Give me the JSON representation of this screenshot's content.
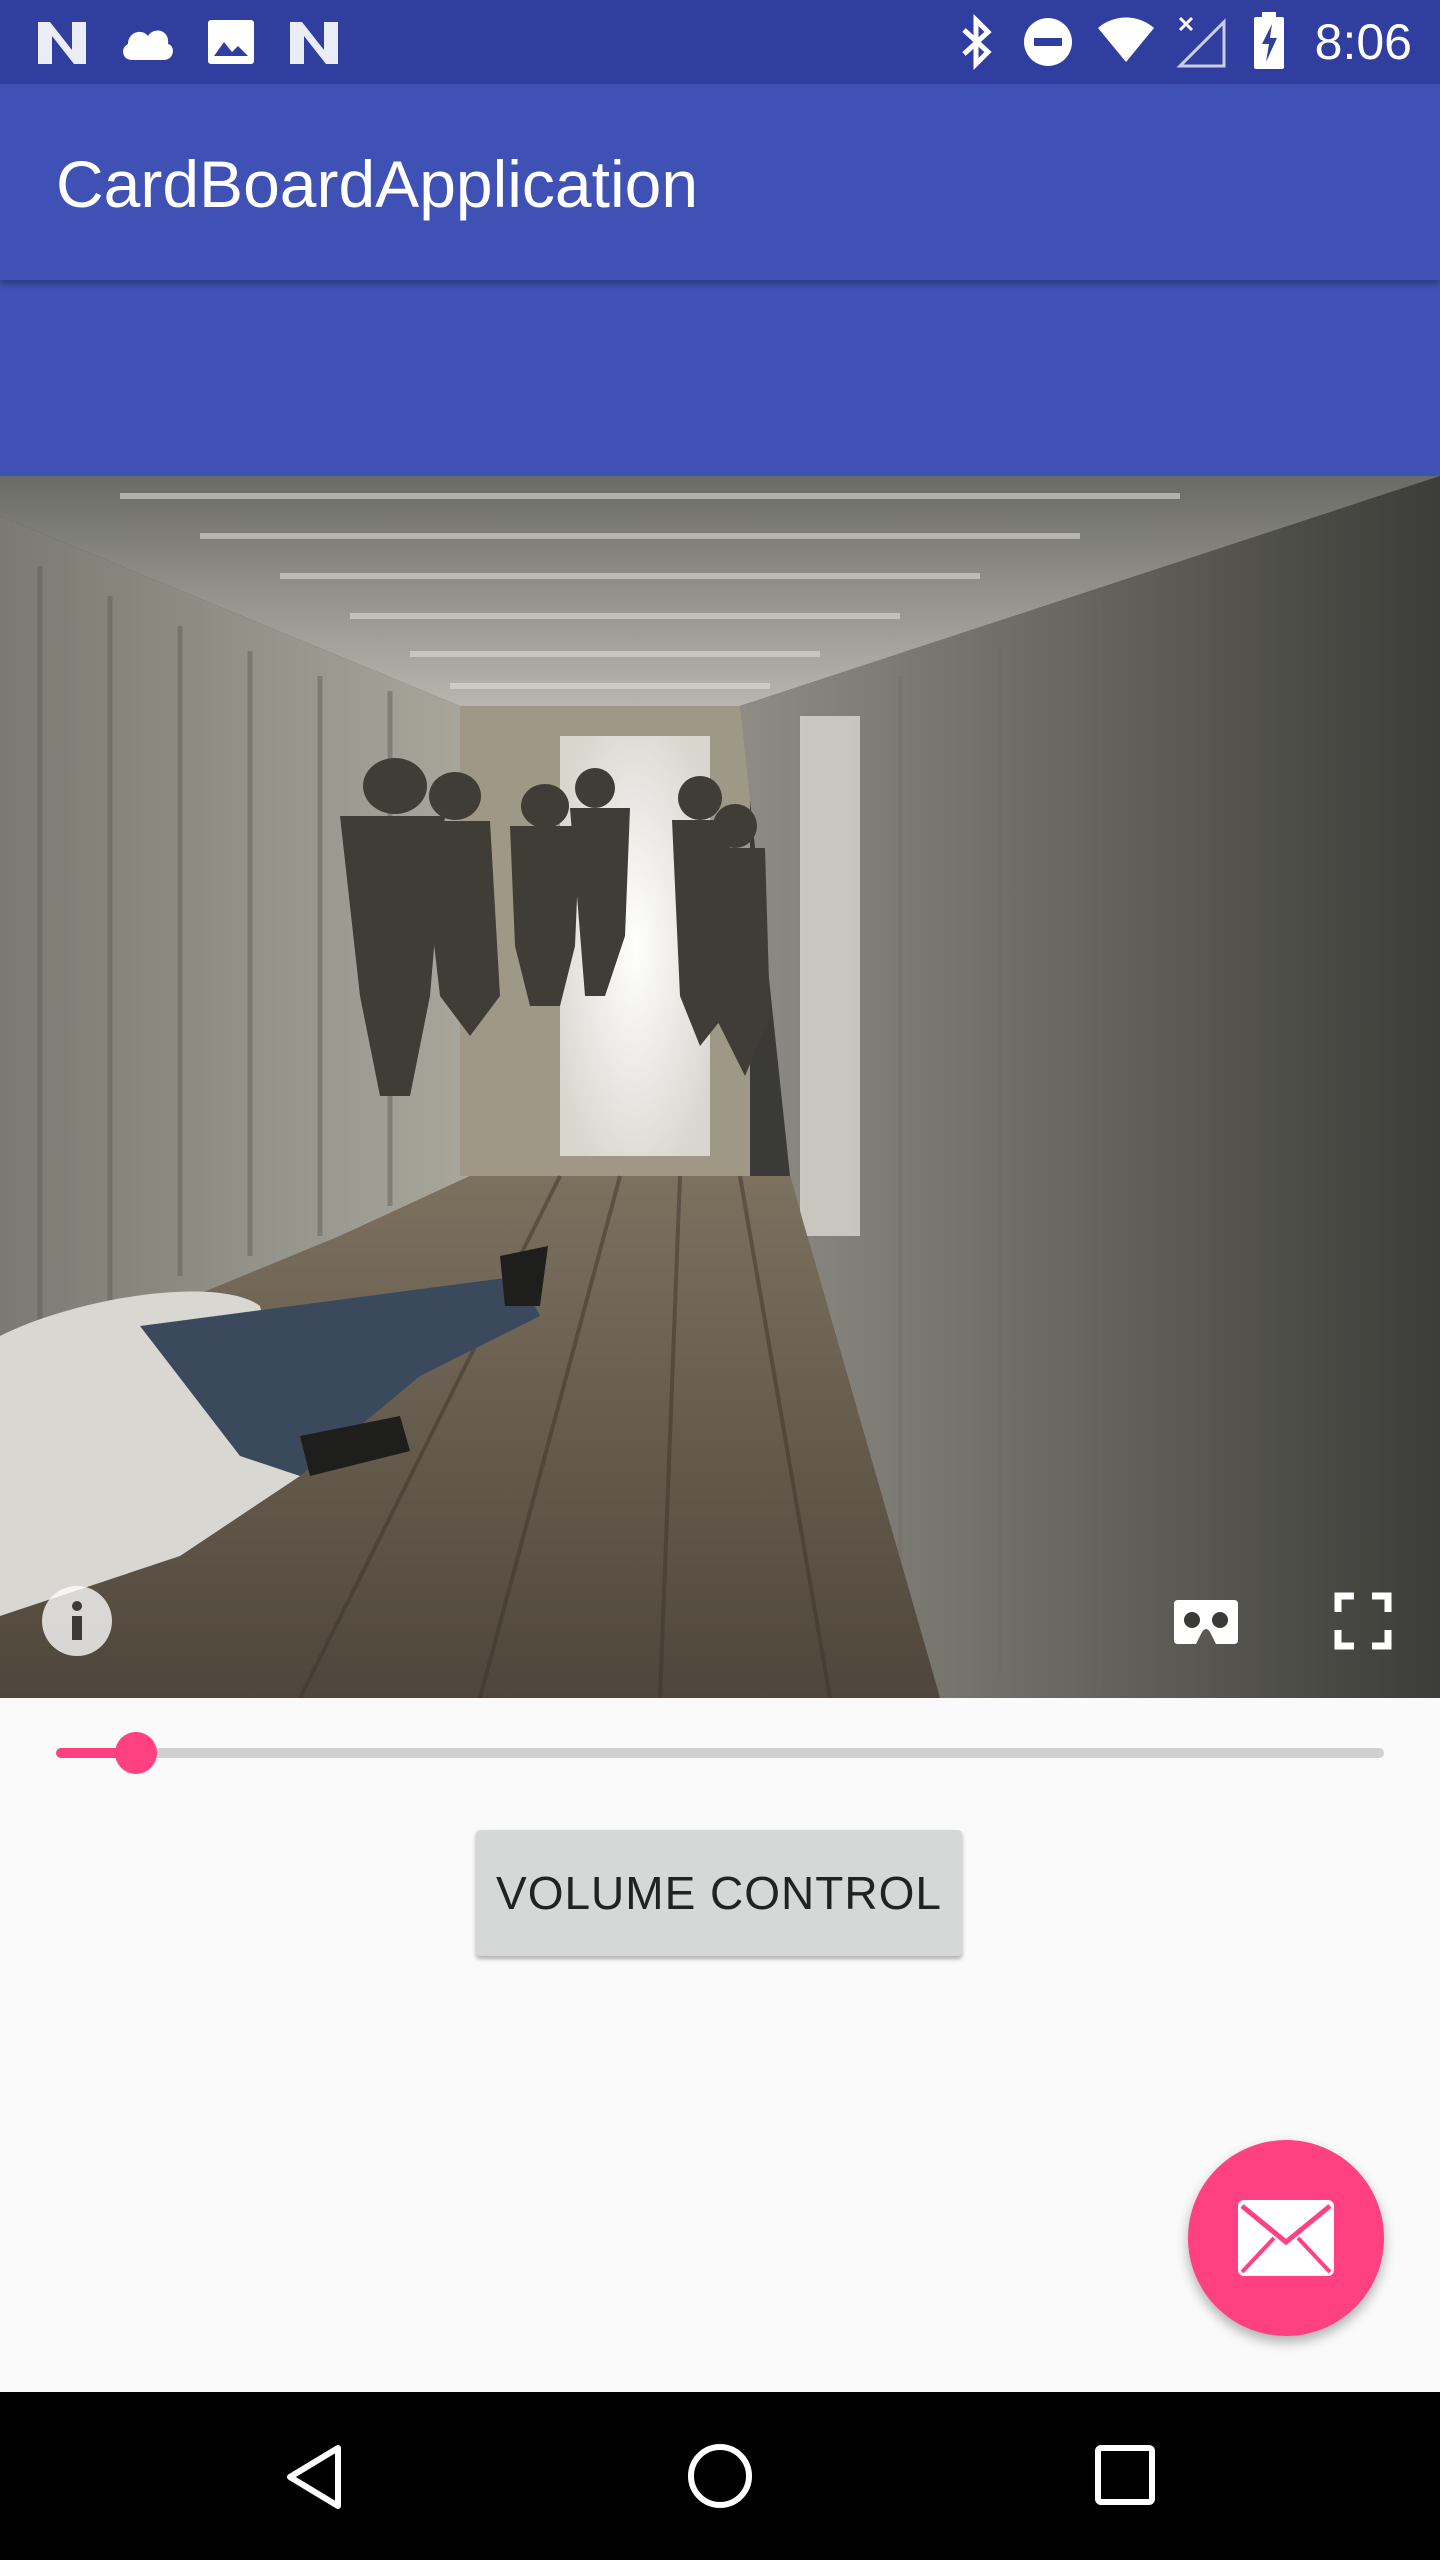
{
  "status_bar": {
    "time": "8:06",
    "left_icons": [
      "n-notification-icon",
      "cloud-icon",
      "image-icon",
      "n-notification-icon"
    ],
    "right_icons": [
      "bluetooth-icon",
      "do-not-disturb-icon",
      "wifi-icon",
      "no-signal-icon",
      "battery-charging-icon"
    ]
  },
  "app_bar": {
    "title": "CardBoardApplication",
    "color": "#3f51b5",
    "status_color": "#303f9f"
  },
  "vr_view": {
    "controls": [
      "info-icon",
      "cardboard-icon",
      "fullscreen-icon"
    ]
  },
  "seek_bar": {
    "progress": 0.06,
    "accent": "#ff4081"
  },
  "volume_button": {
    "label": "VOLUME CONTROL"
  },
  "fab": {
    "icon": "email-icon",
    "color": "#ff4081"
  },
  "nav_bar": {
    "icons": [
      "back-icon",
      "home-icon",
      "recents-icon"
    ]
  }
}
